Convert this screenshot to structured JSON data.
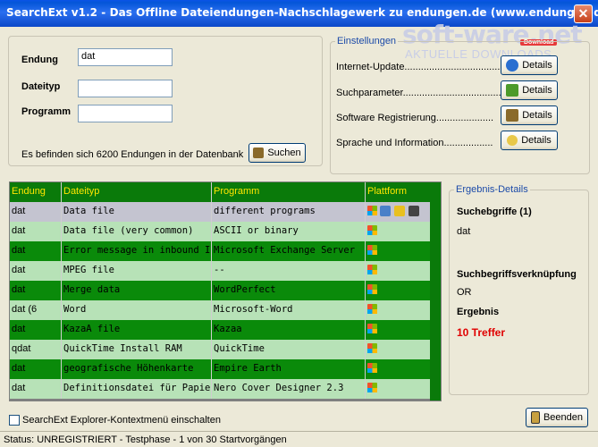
{
  "window": {
    "title": "SearchExt v1.2 - Das Offline Dateiendungen-Nachschlagewerk zu endungen.de (www.endungen.de)",
    "close_label": "✕"
  },
  "watermark": {
    "main": "soft-ware.net",
    "sub": "AKTUELLE DOWNLOADS",
    "badge": "Download"
  },
  "search": {
    "endung_label": "Endung",
    "endung_value": "dat",
    "dateityp_label": "Dateityp",
    "dateityp_value": "",
    "programm_label": "Programm",
    "programm_value": "",
    "info_text": "Es befinden sich 6200 Endungen in der Datenbank",
    "search_button": "Suchen"
  },
  "settings": {
    "legend": "Einstellungen",
    "items": [
      {
        "label": "Internet-Update.....................................",
        "button": "Details",
        "icon": "globe-icon",
        "color": "#2a6fd0"
      },
      {
        "label": "Suchparameter......................................",
        "button": "Details",
        "icon": "search-params-icon",
        "color": "#4c9a2a"
      },
      {
        "label": "Software Registrierung.....................",
        "button": "Details",
        "icon": "register-icon",
        "color": "#8a6a2a"
      },
      {
        "label": "Sprache und Information..................",
        "button": "Details",
        "icon": "lightbulb-icon",
        "color": "#e8c84a"
      }
    ]
  },
  "grid": {
    "columns": [
      "Endung",
      "Dateityp",
      "Programm",
      "Plattform"
    ],
    "rows": [
      {
        "endung": "dat",
        "dateityp": "Data file",
        "programm": "different programs",
        "platforms": [
          "windows",
          "mac",
          "linux",
          "other"
        ],
        "style": "selected"
      },
      {
        "endung": "dat",
        "dateityp": "Data file  (very common)",
        "programm": "ASCII or binary",
        "platforms": [
          "windows"
        ],
        "style": "light"
      },
      {
        "endung": "dat",
        "dateityp": "Error message in inbound Internet",
        "programm": "Microsoft Exchange Server",
        "platforms": [
          "windows"
        ],
        "style": "dark"
      },
      {
        "endung": "dat",
        "dateityp": "MPEG file",
        "programm": "--",
        "platforms": [
          "windows"
        ],
        "style": "light"
      },
      {
        "endung": "dat",
        "dateityp": "Merge data",
        "programm": "WordPerfect",
        "platforms": [
          "windows"
        ],
        "style": "dark"
      },
      {
        "endung": "dat (6",
        "dateityp": "Word",
        "programm": "Microsoft-Word",
        "platforms": [
          "windows"
        ],
        "style": "light"
      },
      {
        "endung": "dat",
        "dateityp": "KazaA file",
        "programm": "Kazaa",
        "platforms": [
          "windows"
        ],
        "style": "dark"
      },
      {
        "endung": "qdat",
        "dateityp": "QuickTime Install RAM",
        "programm": "QuickTime",
        "platforms": [
          "windows"
        ],
        "style": "light"
      },
      {
        "endung": "dat",
        "dateityp": "geografische Höhenkarte",
        "programm": "Empire Earth",
        "platforms": [
          "windows"
        ],
        "style": "dark"
      },
      {
        "endung": "dat",
        "dateityp": "Definitionsdatei für Papierprofile",
        "programm": "Nero Cover Designer 2.3",
        "platforms": [
          "windows"
        ],
        "style": "light"
      }
    ],
    "colors": {
      "header_bg": "#0a7a0a",
      "header_text": "#ffe600",
      "selected_bg": "#c4c4d0",
      "light_bg": "#b7e2b7",
      "dark_bg": "#0a8a0a"
    }
  },
  "results": {
    "legend": "Ergebnis-Details",
    "suchbegriffe_label": "Suchebgriffe (1)",
    "suchbegriffe_value": "dat",
    "verknuepfung_label": "Suchbegriffsverknüpfung",
    "verknuepfung_value": "OR",
    "ergebnis_label": "Ergebnis",
    "ergebnis_value": "10 Treffer",
    "ergebnis_color": "#e00000"
  },
  "footer": {
    "checkbox_label": "SearchExt Explorer-Kontextmenü einschalten",
    "checkbox_checked": false,
    "exit_button": "Beenden",
    "status": "Status: UNREGISTRIERT - Testphase - 1 von 30 Startvorgängen"
  }
}
